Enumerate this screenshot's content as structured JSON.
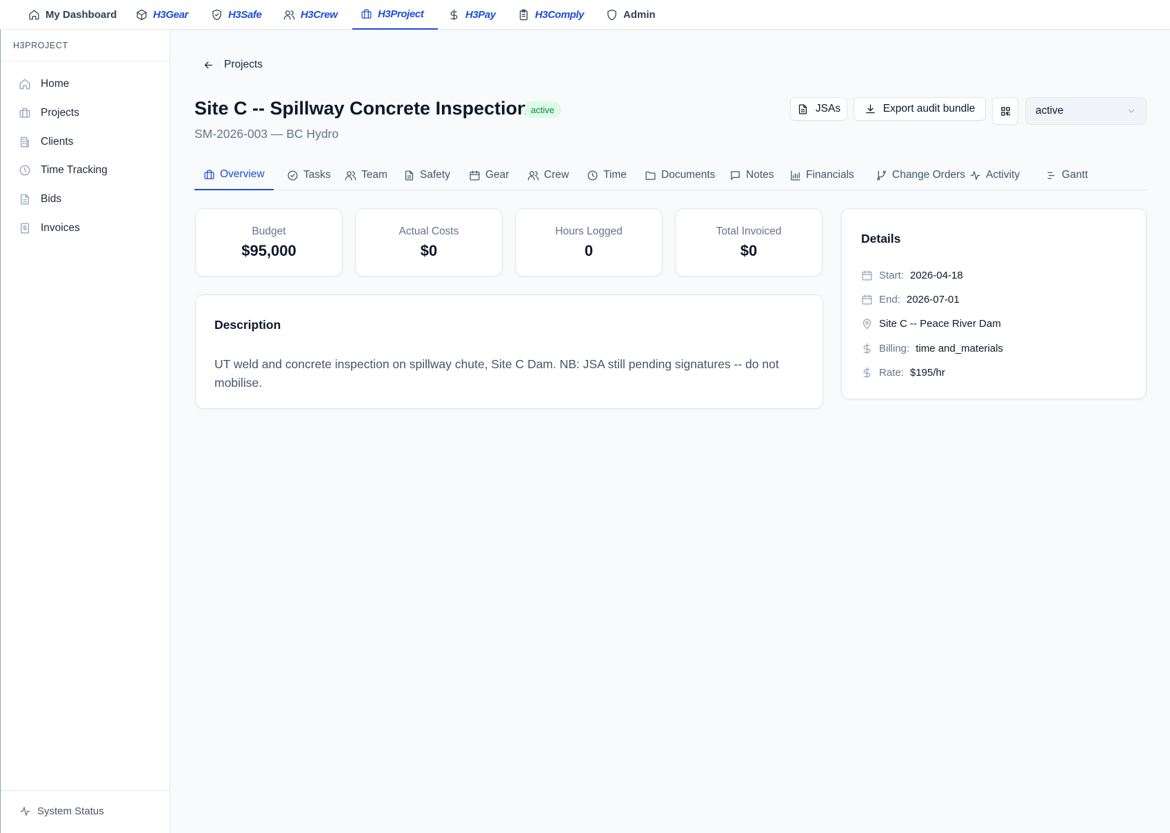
{
  "topnav": {
    "dashboard": "My Dashboard",
    "gear": {
      "h3": "H3",
      "rest": "Gear"
    },
    "safe": {
      "h3": "H3",
      "rest": "Safe"
    },
    "crew": {
      "h3": "H3",
      "rest": "Crew"
    },
    "project": {
      "h3": "H3",
      "rest": "Project"
    },
    "pay": {
      "h3": "H3",
      "rest": "Pay"
    },
    "comply": {
      "h3": "H3",
      "rest": "Comply"
    },
    "admin": "Admin"
  },
  "sidebar": {
    "section_title": "H3PROJECT",
    "items": [
      {
        "label": "Home",
        "icon": "home-icon"
      },
      {
        "label": "Projects",
        "icon": "briefcase-icon"
      },
      {
        "label": "Clients",
        "icon": "building-icon"
      },
      {
        "label": "Time Tracking",
        "icon": "clock-icon"
      },
      {
        "label": "Bids",
        "icon": "file-icon"
      },
      {
        "label": "Invoices",
        "icon": "receipt-icon"
      }
    ],
    "status": "System Status"
  },
  "header": {
    "back_label": "Projects",
    "title": "Site C -- Spillway Concrete Inspection",
    "status_badge": "active",
    "subtitle": "SM-2026-003 — BC Hydro",
    "jsas_label": "JSAs",
    "export_label": "Export audit bundle",
    "status_select": "active"
  },
  "tabs": [
    {
      "label": "Overview"
    },
    {
      "label": "Tasks"
    },
    {
      "label": "Team"
    },
    {
      "label": "Safety"
    },
    {
      "label": "Gear"
    },
    {
      "label": "Crew"
    },
    {
      "label": "Time"
    },
    {
      "label": "Documents"
    },
    {
      "label": "Notes"
    },
    {
      "label": "Financials"
    },
    {
      "label": "Change Orders"
    },
    {
      "label": "Activity"
    },
    {
      "label": "Gantt"
    }
  ],
  "stats": [
    {
      "label": "Budget",
      "value": "$95,000"
    },
    {
      "label": "Actual Costs",
      "value": "$0"
    },
    {
      "label": "Hours Logged",
      "value": "0"
    },
    {
      "label": "Total Invoiced",
      "value": "$0"
    }
  ],
  "description": {
    "heading": "Description",
    "text": "UT weld and concrete inspection on spillway chute, Site C Dam. NB: JSA still pending signatures -- do not mobilise."
  },
  "details": {
    "heading": "Details",
    "start_label": "Start:",
    "start_value": "2026-04-18",
    "end_label": "End:",
    "end_value": "2026-07-01",
    "location": "Site C -- Peace River Dam",
    "billing_label": "Billing:",
    "billing_value": "time and_materials",
    "rate_label": "Rate:",
    "rate_value": "$195/hr"
  },
  "colors": {
    "accent": "#1d4ed8",
    "badge_bg": "#dcfce7",
    "badge_text": "#15803d"
  }
}
